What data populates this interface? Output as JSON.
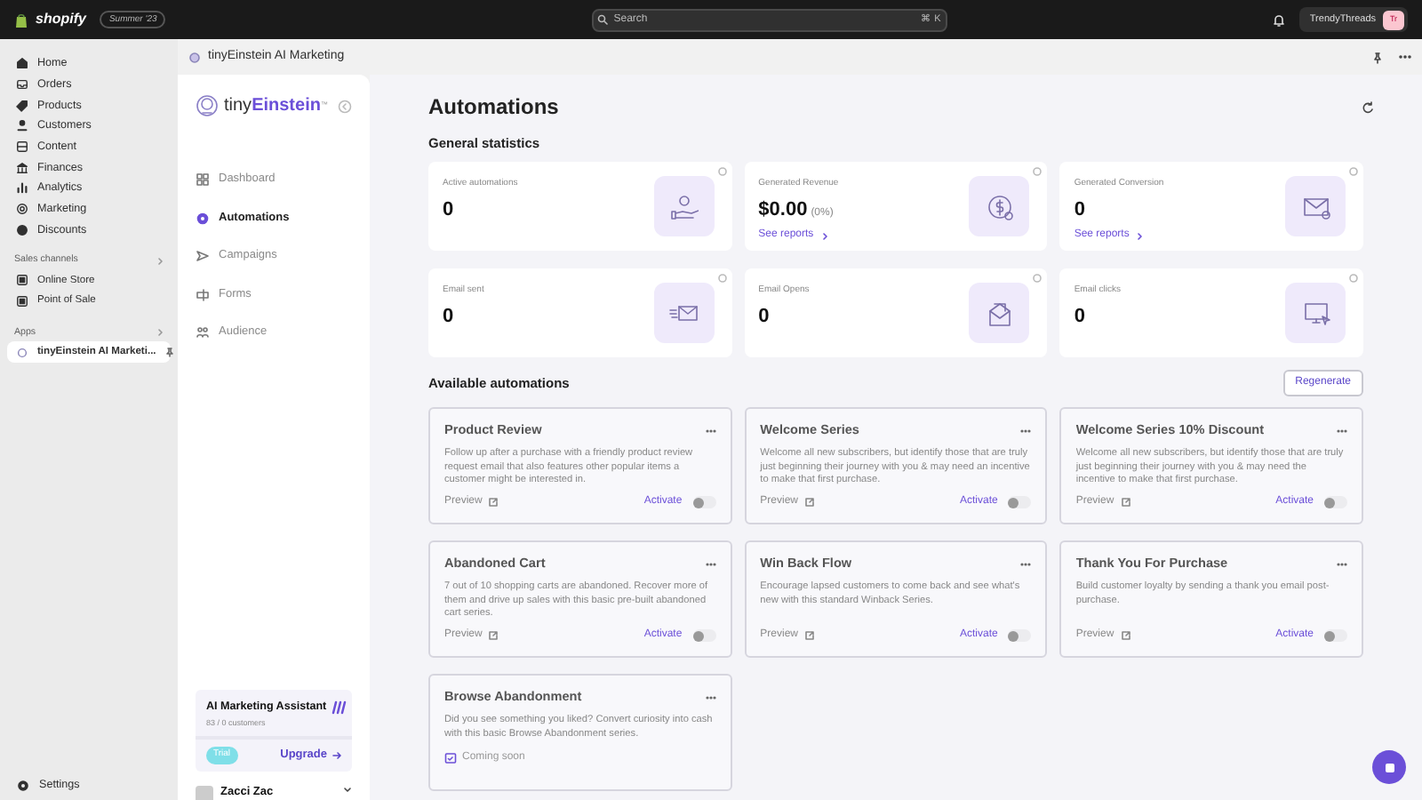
{
  "top_bar": {
    "brand": "shopify",
    "badge": "Summer '23",
    "search_placeholder": "Search",
    "shortcut": "⌘ K",
    "store_name": "TrendyThreads",
    "avatar_initials": "Tr"
  },
  "sidebar": {
    "items": [
      {
        "label": "Home",
        "selected": false
      },
      {
        "label": "Orders",
        "selected": false
      },
      {
        "label": "Products",
        "selected": false
      },
      {
        "label": "Customers",
        "selected": false
      },
      {
        "label": "Content",
        "selected": false
      },
      {
        "label": "Finances",
        "selected": false
      },
      {
        "label": "Analytics",
        "selected": false
      },
      {
        "label": "Marketing",
        "selected": false
      },
      {
        "label": "Discounts",
        "selected": false
      }
    ],
    "sales_channels": {
      "title": "Sales channels",
      "items": [
        {
          "label": "Online Store"
        },
        {
          "label": "Point of Sale"
        }
      ]
    },
    "apps": {
      "title": "Apps",
      "items": [
        {
          "label": "tinyEinstein AI Marketi...",
          "selected": true
        }
      ]
    },
    "settings": "Settings"
  },
  "app_header": {
    "title": "tinyEinstein AI Marketing"
  },
  "app_nav": {
    "logo_prefix": "tiny",
    "logo_name": "Einstein",
    "logo_mark": "™",
    "items": [
      {
        "label": "Dashboard",
        "selected": false
      },
      {
        "label": "Automations",
        "selected": true
      },
      {
        "label": "Campaigns",
        "selected": false
      },
      {
        "label": "Forms",
        "selected": false
      },
      {
        "label": "Audience",
        "selected": false
      }
    ],
    "assistant": {
      "title": "AI Marketing Assistant",
      "usage": "83 / 0 customers",
      "plan": "Trial",
      "upgrade": "Upgrade"
    },
    "user": {
      "name": "Zacci Zac"
    }
  },
  "main": {
    "title": "Automations",
    "general_statistics": {
      "heading": "General statistics",
      "stats": [
        {
          "label": "Active automations",
          "value": "0"
        },
        {
          "label": "Generated Revenue",
          "value": "$0.00",
          "detail": "(0%)",
          "link": "See reports"
        },
        {
          "label": "Generated Conversion",
          "value": "0",
          "link": "See reports"
        },
        {
          "label": "Email sent",
          "value": "0"
        },
        {
          "label": "Email Opens",
          "value": "0"
        },
        {
          "label": "Email clicks",
          "value": "0"
        }
      ]
    },
    "available_automations": {
      "heading": "Available automations",
      "button": "Regenerate",
      "cards": [
        {
          "kind": "toggle",
          "title": "Product Review",
          "description": "Follow up after a purchase with a friendly product review request email that also features other popular items a customer might be interested in.",
          "preview": "Preview",
          "action": "Activate",
          "on": false
        },
        {
          "kind": "toggle",
          "title": "Welcome Series",
          "description": "Welcome all new subscribers, but identify those that are truly just beginning their journey with you & may need an incentive to make that first purchase.",
          "preview": "Preview",
          "action": "Activate",
          "on": false
        },
        {
          "kind": "toggle",
          "title": "Welcome Series 10% Discount",
          "description": "Welcome all new subscribers, but identify those that are truly just beginning their journey with you & may need the incentive to make that first purchase.",
          "preview": "Preview",
          "action": "Activate",
          "on": false
        },
        {
          "kind": "toggle",
          "title": "Abandoned Cart",
          "description": "7 out of 10 shopping carts are abandoned. Recover more of them and drive up sales with this basic pre-built abandoned cart series.",
          "preview": "Preview",
          "action": "Activate",
          "on": false
        },
        {
          "kind": "toggle",
          "title": "Win Back Flow",
          "description": "Encourage lapsed customers to come back and see what's new with this standard Winback Series.",
          "preview": "Preview",
          "action": "Activate",
          "on": false
        },
        {
          "kind": "toggle",
          "title": "Thank You For Purchase",
          "description": "Build customer loyalty by sending a thank you email post-purchase.",
          "preview": "Preview",
          "action": "Activate",
          "on": false
        },
        {
          "kind": "coming_soon",
          "title": "Browse Abandonment",
          "description": "Did you see something you liked? Convert curiosity into cash with this basic Browse Abandonment series.",
          "status": "Coming soon"
        }
      ]
    }
  }
}
